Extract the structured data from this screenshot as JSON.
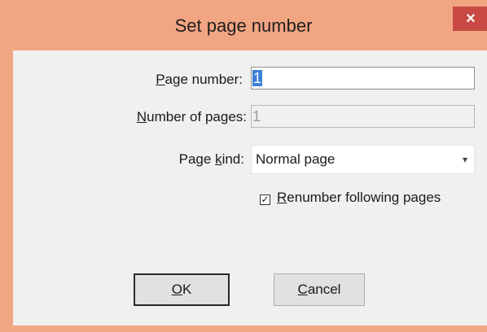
{
  "dialog": {
    "title": "Set page number",
    "close_label": "×"
  },
  "page_number": {
    "label_accel": "P",
    "label_rest": "age number:",
    "value": "1"
  },
  "number_of_pages": {
    "label_accel": "N",
    "label_rest": "umber of pages:",
    "value": "1"
  },
  "page_kind": {
    "label_pre": "Page ",
    "label_accel": "k",
    "label_rest": "ind:",
    "selected": "Normal page",
    "arrow": "▾"
  },
  "renumber": {
    "checked": true,
    "check_glyph": "✓",
    "label_accel": "R",
    "label_rest": "enumber following pages"
  },
  "buttons": {
    "ok_accel": "O",
    "ok_rest": "K",
    "cancel_accel": "C",
    "cancel_rest": "ancel"
  }
}
